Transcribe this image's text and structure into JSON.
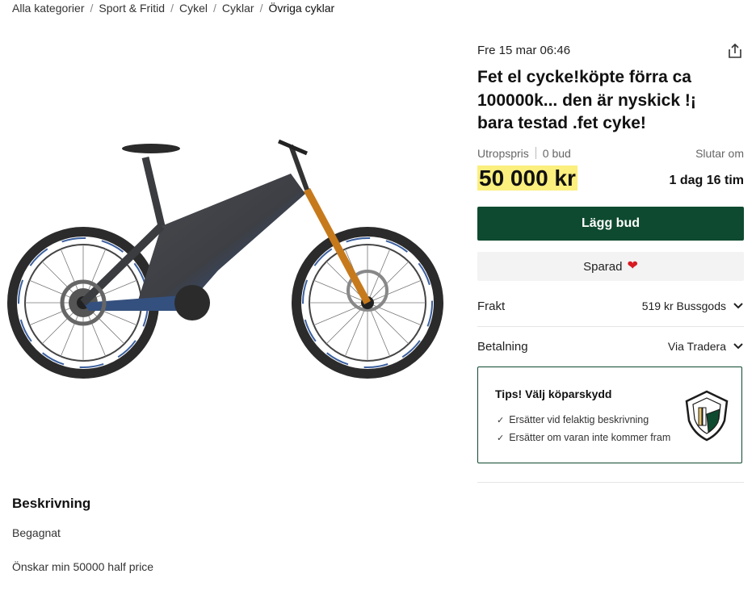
{
  "breadcrumb": {
    "items": [
      "Alla kategorier",
      "Sport & Fritid",
      "Cykel",
      "Cyklar"
    ],
    "current": "Övriga cyklar",
    "separator": "/"
  },
  "listing": {
    "date": "Fre 15 mar 06:46",
    "title": "Fet el cycke!köpte förra ca 100000k... den är nyskick !¡ bara testad .fet cyke!",
    "price_type": "Utropspris",
    "bids": "0 bud",
    "ends_label": "Slutar om",
    "price": "50 000 kr",
    "time_left": "1 dag 16 tim"
  },
  "actions": {
    "bid_label": "Lägg bud",
    "saved_label": "Sparad"
  },
  "shipping": {
    "label": "Frakt",
    "value": "519 kr Bussgods"
  },
  "payment": {
    "label": "Betalning",
    "value": "Via Tradera"
  },
  "protection": {
    "title": "Tips! Välj köparskydd",
    "items": [
      "Ersätter vid felaktig beskrivning",
      "Ersätter om varan inte kommer fram"
    ]
  },
  "description": {
    "heading": "Beskrivning",
    "condition": "Begagnat",
    "text": "Önskar min 50000 half price"
  },
  "colors": {
    "brand_green": "#0e4a2f",
    "price_highlight": "#fbef7e",
    "heart": "#d81b23"
  },
  "icons": {
    "share": "share-icon",
    "chevron": "chevron-down-icon",
    "heart": "heart-icon",
    "check": "check-icon",
    "shield": "shield-icon"
  }
}
